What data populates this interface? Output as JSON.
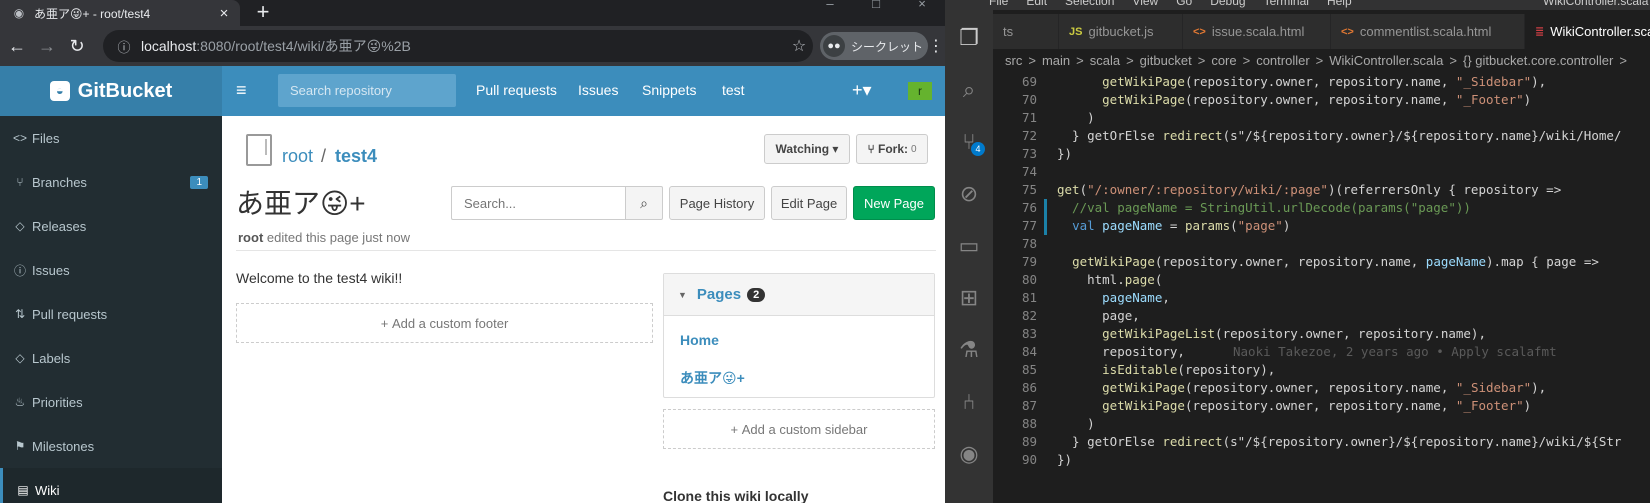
{
  "browser": {
    "tab_title": "あ亜ア😜+ - root/test4",
    "new_tab_label": "+",
    "url_host": "localhost",
    "url_path": ":8080/root/test4/wiki/あ亜ア😜%2B",
    "incognito_label": "シークレット"
  },
  "gitbucket": {
    "brand": "GitBucket",
    "search_placeholder": "Search repository",
    "nav": [
      "Pull requests",
      "Issues",
      "Snippets",
      "test"
    ],
    "avatar_letter": "r",
    "sidebar": [
      {
        "icon": "<>",
        "label": "Files"
      },
      {
        "icon": "⑂",
        "label": "Branches",
        "badge": "1"
      },
      {
        "icon": "◇",
        "label": "Releases"
      },
      {
        "icon": "ⓘ",
        "label": "Issues"
      },
      {
        "icon": "⇅",
        "label": "Pull requests"
      },
      {
        "icon": "◇",
        "label": "Labels"
      },
      {
        "icon": "♨",
        "label": "Priorities"
      },
      {
        "icon": "⚑",
        "label": "Milestones"
      },
      {
        "icon": "▤",
        "label": "Wiki"
      }
    ],
    "repo_owner": "root",
    "repo_sep": "/",
    "repo_name": "test4",
    "watching_label": "Watching",
    "fork_label": "Fork:",
    "fork_count": "0",
    "page_title": "あ亜ア😜+",
    "edited_user": "root",
    "edited_text": "edited this page just now",
    "wiki_search_placeholder": "Search...",
    "page_history_label": "Page History",
    "edit_page_label": "Edit Page",
    "new_page_label": "New Page",
    "welcome_text": "Welcome to the test4 wiki!!",
    "add_footer_label": "Add a custom footer",
    "pages_label": "Pages",
    "pages_count": "2",
    "pages": [
      "Home",
      "あ亜ア😜+"
    ],
    "add_sidebar_label": "Add a custom sidebar",
    "clone_label": "Clone this wiki locally"
  },
  "vscode": {
    "menu": [
      "File",
      "Edit",
      "Selection",
      "View",
      "Go",
      "Debug",
      "Terminal",
      "Help"
    ],
    "window_title": "WikiController.scala - gitbucket - Visual S",
    "tabs": [
      {
        "icon": "",
        "label": "ts"
      },
      {
        "icon": "JS",
        "label": "gitbucket.js"
      },
      {
        "icon": "<>",
        "label": "issue.scala.html"
      },
      {
        "icon": "<>",
        "label": "commentlist.scala.html"
      },
      {
        "icon": "≣",
        "label": "WikiController.scala"
      }
    ],
    "breadcrumb": [
      "src",
      ">",
      "main",
      ">",
      "scala",
      ">",
      "gitbucket",
      ">",
      "core",
      ">",
      "controller",
      ">",
      "WikiController.scala",
      ">",
      "{} gitbucket.core.controller",
      ">"
    ],
    "scm_badge": "4",
    "line_numbers": [
      "69",
      "70",
      "71",
      "72",
      "73",
      "74",
      "75",
      "76",
      "77",
      "78",
      "79",
      "80",
      "81",
      "82",
      "83",
      "84",
      "85",
      "86",
      "87",
      "88",
      "89",
      "90"
    ],
    "code_lines": [
      "      getWikiPage(repository.owner, repository.name, \"_Sidebar\"),",
      "      getWikiPage(repository.owner, repository.name, \"_Footer\")",
      "    )",
      "  } getOrElse redirect(s\"/${repository.owner}/${repository.name}/wiki/Home/",
      "})",
      "",
      "get(\"/:owner/:repository/wiki/:page\")(referrersOnly { repository =>",
      "  //val pageName = StringUtil.urlDecode(params(\"page\"))",
      "  val pageName = params(\"page\")",
      "",
      "  getWikiPage(repository.owner, repository.name, pageName).map { page =>",
      "    html.page(",
      "      pageName,",
      "      page,",
      "      getWikiPageList(repository.owner, repository.name),",
      "      repository,",
      "      isEditable(repository),",
      "      getWikiPage(repository.owner, repository.name, \"_Sidebar\"),",
      "      getWikiPage(repository.owner, repository.name, \"_Footer\")",
      "    )",
      "  } getOrElse redirect(s\"/${repository.owner}/${repository.name}/wiki/${Str",
      "})"
    ],
    "blame_text": "Naoki Takezoe, 2 years ago • Apply scalafmt"
  }
}
